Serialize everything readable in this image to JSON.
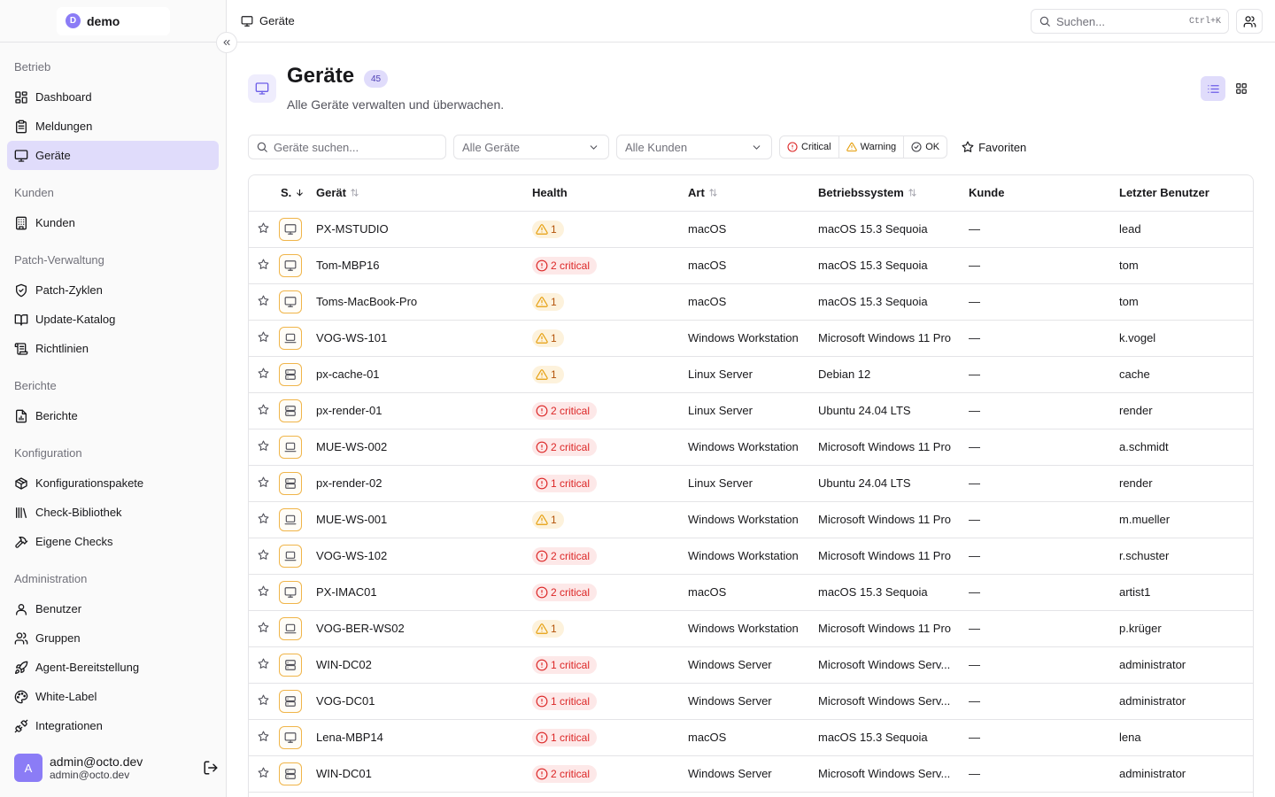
{
  "brand": {
    "logo_letter": "D",
    "name": "demo"
  },
  "colors": {
    "accent": "#8b7cf6",
    "accent_soft": "#e0dcfb",
    "warning": "#f0b54a",
    "critical": "#dc2626"
  },
  "sidebar": {
    "sections": [
      {
        "title": "Betrieb",
        "items": [
          {
            "label": "Dashboard",
            "icon": "dashboard-icon",
            "active": false
          },
          {
            "label": "Meldungen",
            "icon": "clipboard-icon",
            "active": false
          },
          {
            "label": "Geräte",
            "icon": "monitor-icon",
            "active": true
          }
        ]
      },
      {
        "title": "Kunden",
        "items": [
          {
            "label": "Kunden",
            "icon": "building-icon",
            "active": false
          }
        ]
      },
      {
        "title": "Patch-Verwaltung",
        "items": [
          {
            "label": "Patch-Zyklen",
            "icon": "shield-icon",
            "active": false
          },
          {
            "label": "Update-Katalog",
            "icon": "book-icon",
            "active": false
          },
          {
            "label": "Richtlinien",
            "icon": "scroll-icon",
            "active": false
          }
        ]
      },
      {
        "title": "Berichte",
        "items": [
          {
            "label": "Berichte",
            "icon": "report-icon",
            "active": false
          }
        ]
      },
      {
        "title": "Konfiguration",
        "items": [
          {
            "label": "Konfigurationspakete",
            "icon": "package-icon",
            "active": false
          },
          {
            "label": "Check-Bibliothek",
            "icon": "library-icon",
            "active": false
          },
          {
            "label": "Eigene Checks",
            "icon": "hammer-icon",
            "active": false
          }
        ]
      },
      {
        "title": "Administration",
        "items": [
          {
            "label": "Benutzer",
            "icon": "user-icon",
            "active": false
          },
          {
            "label": "Gruppen",
            "icon": "users-icon",
            "active": false
          },
          {
            "label": "Agent-Bereitstellung",
            "icon": "rocket-icon",
            "active": false
          },
          {
            "label": "White-Label",
            "icon": "palette-icon",
            "active": false
          },
          {
            "label": "Integrationen",
            "icon": "plug-icon",
            "active": false
          }
        ]
      }
    ],
    "user": {
      "avatar_letter": "A",
      "name": "admin@octo.dev",
      "email": "admin@octo.dev"
    }
  },
  "topbar": {
    "breadcrumb": "Geräte",
    "search_placeholder": "Suchen...",
    "search_shortcut": "Ctrl+K"
  },
  "page": {
    "title": "Geräte",
    "count": "45",
    "subtitle": "Alle Geräte verwalten und überwachen."
  },
  "filters": {
    "search_placeholder": "Geräte suchen...",
    "device_select": "Alle Geräte",
    "customer_select": "Alle Kunden",
    "status_buttons": [
      "Critical",
      "Warning",
      "OK"
    ],
    "favorites_label": "Favoriten"
  },
  "table": {
    "columns": [
      "S.",
      "Gerät",
      "Health",
      "Art",
      "Betriebssystem",
      "Kunde",
      "Letzter Benutzer"
    ],
    "rows": [
      {
        "name": "PX-MSTUDIO",
        "icon": "monitor",
        "health_level": "warn",
        "health": "1",
        "type": "macOS",
        "os": "macOS 15.3 Sequoia",
        "customer": "—",
        "user": "lead"
      },
      {
        "name": "Tom-MBP16",
        "icon": "monitor",
        "health_level": "crit",
        "health": "2 critical",
        "type": "macOS",
        "os": "macOS 15.3 Sequoia",
        "customer": "—",
        "user": "tom"
      },
      {
        "name": "Toms-MacBook-Pro",
        "icon": "monitor",
        "health_level": "warn",
        "health": "1",
        "type": "macOS",
        "os": "macOS 15.3 Sequoia",
        "customer": "—",
        "user": "tom"
      },
      {
        "name": "VOG-WS-101",
        "icon": "laptop",
        "health_level": "warn",
        "health": "1",
        "type": "Windows Workstation",
        "os": "Microsoft Windows 11 Pro",
        "customer": "—",
        "user": "k.vogel"
      },
      {
        "name": "px-cache-01",
        "icon": "server",
        "health_level": "warn",
        "health": "1",
        "type": "Linux Server",
        "os": "Debian 12",
        "customer": "—",
        "user": "cache"
      },
      {
        "name": "px-render-01",
        "icon": "server",
        "health_level": "crit",
        "health": "2 critical",
        "type": "Linux Server",
        "os": "Ubuntu 24.04 LTS",
        "customer": "—",
        "user": "render"
      },
      {
        "name": "MUE-WS-002",
        "icon": "laptop",
        "health_level": "crit",
        "health": "2 critical",
        "type": "Windows Workstation",
        "os": "Microsoft Windows 11 Pro",
        "customer": "—",
        "user": "a.schmidt"
      },
      {
        "name": "px-render-02",
        "icon": "server",
        "health_level": "crit",
        "health": "1 critical",
        "type": "Linux Server",
        "os": "Ubuntu 24.04 LTS",
        "customer": "—",
        "user": "render"
      },
      {
        "name": "MUE-WS-001",
        "icon": "laptop",
        "health_level": "warn",
        "health": "1",
        "type": "Windows Workstation",
        "os": "Microsoft Windows 11 Pro",
        "customer": "—",
        "user": "m.mueller"
      },
      {
        "name": "VOG-WS-102",
        "icon": "laptop",
        "health_level": "crit",
        "health": "2 critical",
        "type": "Windows Workstation",
        "os": "Microsoft Windows 11 Pro",
        "customer": "—",
        "user": "r.schuster"
      },
      {
        "name": "PX-IMAC01",
        "icon": "monitor",
        "health_level": "crit",
        "health": "2 critical",
        "type": "macOS",
        "os": "macOS 15.3 Sequoia",
        "customer": "—",
        "user": "artist1"
      },
      {
        "name": "VOG-BER-WS02",
        "icon": "laptop",
        "health_level": "warn",
        "health": "1",
        "type": "Windows Workstation",
        "os": "Microsoft Windows 11 Pro",
        "customer": "—",
        "user": "p.krüger"
      },
      {
        "name": "WIN-DC02",
        "icon": "server",
        "health_level": "crit",
        "health": "1 critical",
        "type": "Windows Server",
        "os": "Microsoft Windows Serv...",
        "customer": "—",
        "user": "administrator"
      },
      {
        "name": "VOG-DC01",
        "icon": "server",
        "health_level": "crit",
        "health": "1 critical",
        "type": "Windows Server",
        "os": "Microsoft Windows Serv...",
        "customer": "—",
        "user": "administrator"
      },
      {
        "name": "Lena-MBP14",
        "icon": "monitor",
        "health_level": "crit",
        "health": "1 critical",
        "type": "macOS",
        "os": "macOS 15.3 Sequoia",
        "customer": "—",
        "user": "lena"
      },
      {
        "name": "WIN-DC01",
        "icon": "server",
        "health_level": "crit",
        "health": "2 critical",
        "type": "Windows Server",
        "os": "Microsoft Windows Serv...",
        "customer": "—",
        "user": "administrator"
      }
    ]
  }
}
